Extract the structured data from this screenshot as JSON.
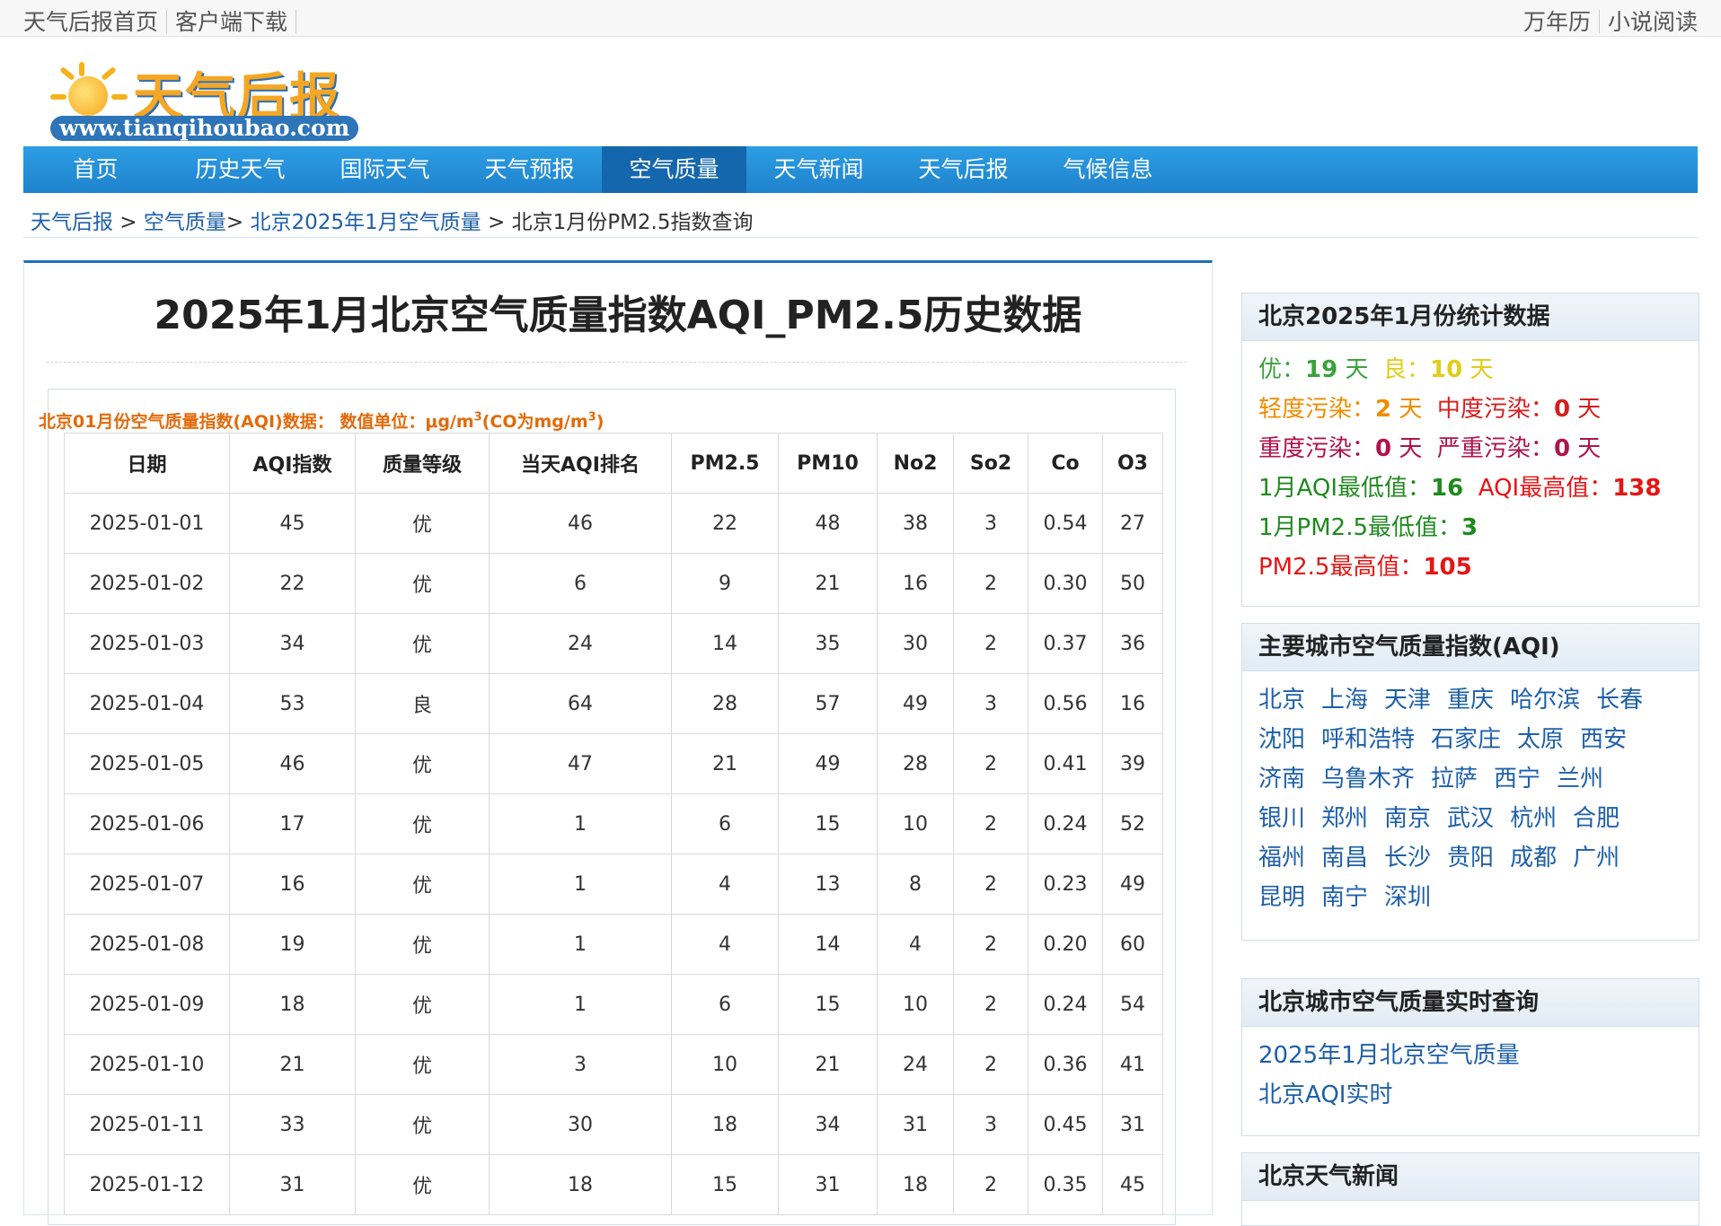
{
  "topbar": {
    "left_links": [
      "天气后报首页",
      "客户端下载"
    ],
    "right_links": [
      "万年历",
      "小说阅读"
    ]
  },
  "logo": {
    "brand": "天气后报",
    "url": "www.tianqihoubao.com"
  },
  "nav": [
    "首页",
    "历史天气",
    "国际天气",
    "天气预报",
    "空气质量",
    "天气新闻",
    "天气后报",
    "气候信息"
  ],
  "nav_active": "空气质量",
  "breadcrumb": {
    "items": [
      "天气后报",
      "空气质量",
      "北京2025年1月空气质量"
    ],
    "current": "北京1月份PM2.5指数查询"
  },
  "page_title": "2025年1月北京空气质量指数AQI_PM2.5历史数据",
  "table_caption": {
    "prefix": "北京01月份空气质量指数(AQI)数据： 数值单位：μg/m",
    "mid": "(CO为mg/m",
    "end": ")"
  },
  "table": {
    "headers": [
      "日期",
      "AQI指数",
      "质量等级",
      "当天AQI排名",
      "PM2.5",
      "PM10",
      "No2",
      "So2",
      "Co",
      "O3"
    ],
    "rows": [
      [
        "2025-01-01",
        "45",
        "优",
        "46",
        "22",
        "48",
        "38",
        "3",
        "0.54",
        "27"
      ],
      [
        "2025-01-02",
        "22",
        "优",
        "6",
        "9",
        "21",
        "16",
        "2",
        "0.30",
        "50"
      ],
      [
        "2025-01-03",
        "34",
        "优",
        "24",
        "14",
        "35",
        "30",
        "2",
        "0.37",
        "36"
      ],
      [
        "2025-01-04",
        "53",
        "良",
        "64",
        "28",
        "57",
        "49",
        "3",
        "0.56",
        "16"
      ],
      [
        "2025-01-05",
        "46",
        "优",
        "47",
        "21",
        "49",
        "28",
        "2",
        "0.41",
        "39"
      ],
      [
        "2025-01-06",
        "17",
        "优",
        "1",
        "6",
        "15",
        "10",
        "2",
        "0.24",
        "52"
      ],
      [
        "2025-01-07",
        "16",
        "优",
        "1",
        "4",
        "13",
        "8",
        "2",
        "0.23",
        "49"
      ],
      [
        "2025-01-08",
        "19",
        "优",
        "1",
        "4",
        "14",
        "4",
        "2",
        "0.20",
        "60"
      ],
      [
        "2025-01-09",
        "18",
        "优",
        "1",
        "6",
        "15",
        "10",
        "2",
        "0.24",
        "54"
      ],
      [
        "2025-01-10",
        "21",
        "优",
        "3",
        "10",
        "21",
        "24",
        "2",
        "0.36",
        "41"
      ],
      [
        "2025-01-11",
        "33",
        "优",
        "30",
        "18",
        "34",
        "31",
        "3",
        "0.45",
        "31"
      ],
      [
        "2025-01-12",
        "31",
        "优",
        "18",
        "15",
        "31",
        "18",
        "2",
        "0.35",
        "45"
      ]
    ]
  },
  "stats": {
    "title": "北京2025年1月份统计数据",
    "good_label": "优：",
    "good": "19",
    "fine_label": "良：",
    "fine": "10",
    "day": "天",
    "light_label": "轻度污染：",
    "light": "2",
    "moderate_label": "中度污染：",
    "moderate": "0",
    "heavy_label": "重度污染：",
    "heavy": "0",
    "severe_label": "严重污染：",
    "severe": "0",
    "aqi_min_label": "1月AQI最低值：",
    "aqi_min": "16",
    "aqi_max_label": "AQI最高值：",
    "aqi_max": "138",
    "pm_min_label": "1月PM2.5最低值：",
    "pm_min": "3",
    "pm_max_label": "PM2.5最高值：",
    "pm_max": "105"
  },
  "cities": {
    "title": "主要城市空气质量指数(AQI)",
    "rows": [
      [
        "北京",
        "上海",
        "天津",
        "重庆",
        "哈尔滨",
        "长春"
      ],
      [
        "沈阳",
        "呼和浩特",
        "石家庄",
        "太原",
        "西安"
      ],
      [
        "济南",
        "乌鲁木齐",
        "拉萨",
        "西宁",
        "兰州"
      ],
      [
        "银川",
        "郑州",
        "南京",
        "武汉",
        "杭州",
        "合肥"
      ],
      [
        "福州",
        "南昌",
        "长沙",
        "贵阳",
        "成都",
        "广州"
      ],
      [
        "昆明",
        "南宁",
        "深圳"
      ]
    ]
  },
  "realtime": {
    "title": "北京城市空气质量实时查询",
    "links": [
      "2025年1月北京空气质量",
      "北京AQI实时"
    ]
  },
  "news": {
    "title": "北京天气新闻"
  },
  "colors": {
    "nav": "#1e82cc",
    "good": "#4cc94c",
    "fine": "#e2cc1b",
    "caption": "#e36a0a"
  }
}
